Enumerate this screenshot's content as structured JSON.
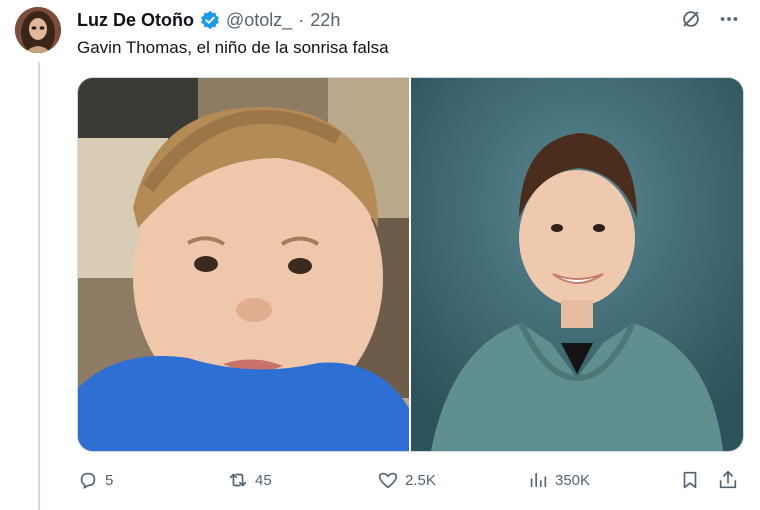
{
  "post": {
    "author_name": "Luz De Otoño",
    "handle": "@otolz_",
    "separator": "·",
    "time": "22h",
    "text": "Gavin Thomas, el niño de la sonrisa falsa"
  },
  "top_icons": [
    "grok-icon",
    "more-icon"
  ],
  "media": {
    "images": [
      {
        "icon": "photo-toddler-frown"
      },
      {
        "icon": "photo-boy-school-portrait"
      }
    ]
  },
  "actions": {
    "replies": "5",
    "reposts": "45",
    "likes": "2.5K",
    "views": "350K"
  },
  "colors": {
    "verified": "#1d9bf0",
    "text_secondary": "#536471",
    "border": "#cfd9de"
  }
}
